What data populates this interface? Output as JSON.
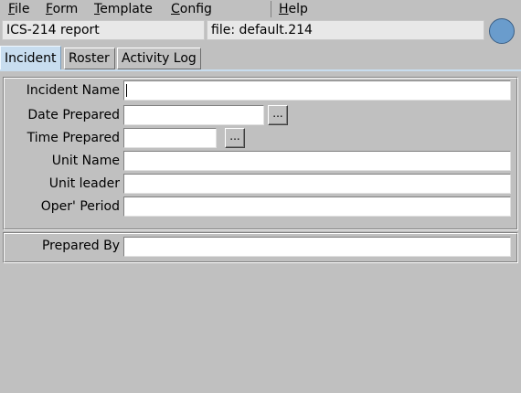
{
  "menubar": {
    "items": [
      {
        "pre": "",
        "mnemonic": "F",
        "post": "ile"
      },
      {
        "pre": "",
        "mnemonic": "F",
        "post": "orm"
      },
      {
        "pre": "",
        "mnemonic": "T",
        "post": "emplate"
      },
      {
        "pre": "",
        "mnemonic": "C",
        "post": "onfig"
      },
      {
        "pre": "",
        "mnemonic": "H",
        "post": "elp"
      }
    ]
  },
  "header": {
    "report_title": "ICS-214 report",
    "file_label": "file: default.214",
    "status_color": "#6a9ccc"
  },
  "tabs": [
    {
      "label": "Incident",
      "active": true
    },
    {
      "label": "Roster",
      "active": false
    },
    {
      "label": "Activity Log",
      "active": false
    }
  ],
  "incident_form": {
    "incident_name": {
      "label": "Incident Name",
      "value": ""
    },
    "date_prepared": {
      "label": "Date Prepared",
      "value": "",
      "picker_label": "..."
    },
    "time_prepared": {
      "label": "Time Prepared",
      "value": "",
      "picker_label": "..."
    },
    "unit_name": {
      "label": "Unit Name",
      "value": ""
    },
    "unit_leader": {
      "label": "Unit leader",
      "value": ""
    },
    "oper_period": {
      "label": "Oper' Period",
      "value": ""
    }
  },
  "prepared_form": {
    "prepared_by": {
      "label": "Prepared By",
      "value": ""
    }
  }
}
